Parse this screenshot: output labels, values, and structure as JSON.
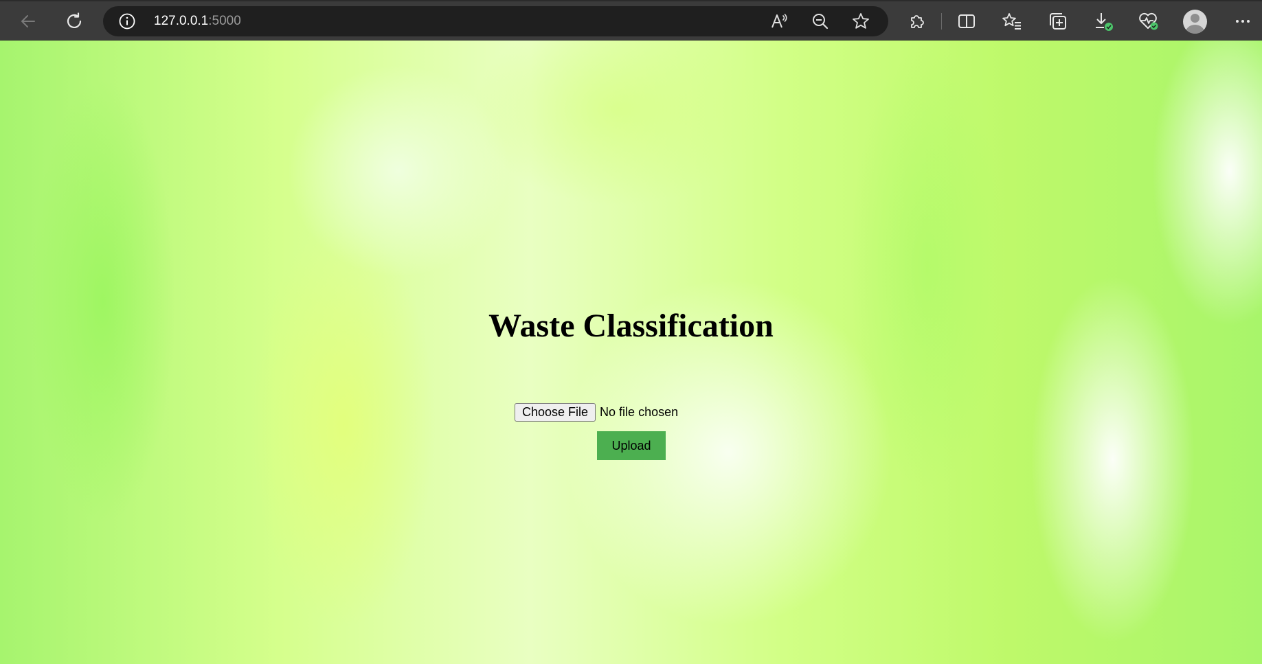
{
  "browser": {
    "url_host": "127.0.0.1",
    "url_port": ":5000",
    "toolbar_icons": [
      "back-icon",
      "refresh-icon",
      "site-info-icon",
      "read-aloud-icon",
      "zoom-out-icon",
      "favorite-star-icon",
      "extensions-icon",
      "split-screen-icon",
      "favorites-icon",
      "collections-icon",
      "downloads-icon",
      "browser-essentials-icon",
      "profile-avatar",
      "more-menu-icon"
    ],
    "accent_badge_color": "#4cc46a"
  },
  "page": {
    "title": "Waste Classification",
    "choose_file_label": "Choose File",
    "file_status": "No file chosen",
    "upload_label": "Upload",
    "upload_button_color": "#4caf50"
  }
}
